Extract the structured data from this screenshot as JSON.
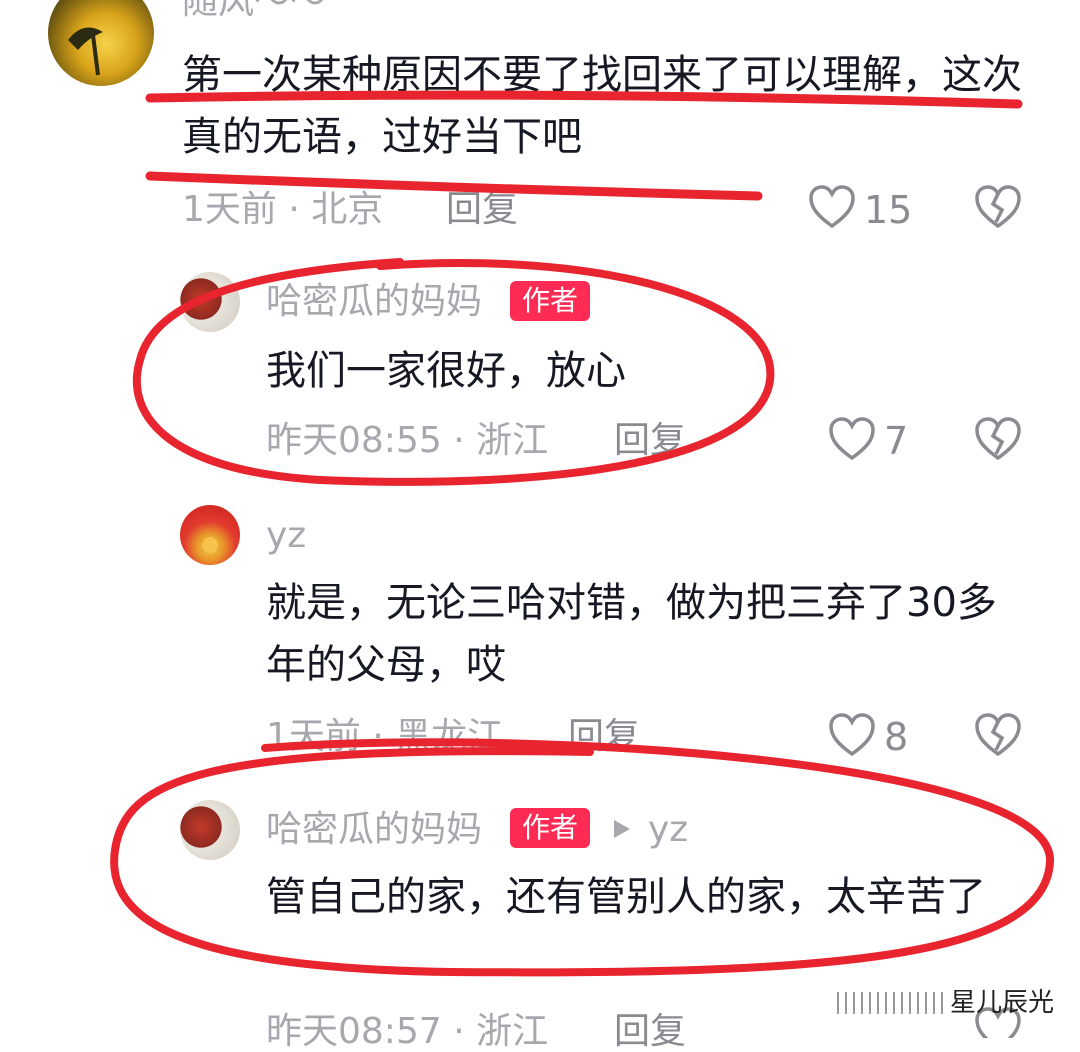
{
  "colors": {
    "accent": "#fe2c55",
    "annotation": "#e8242f",
    "meta": "#a7a8ad"
  },
  "comments": [
    {
      "name": "随风～～",
      "text": "第一次某种原因不要了找回来了可以理解，这次真的无语，过好当下吧",
      "time": "1天前 · 北京",
      "reply": "回复",
      "likes": "15"
    },
    {
      "name": "哈密瓜的妈妈",
      "badge": "作者",
      "text": "我们一家很好，放心",
      "time": "昨天08:55 · 浙江",
      "reply": "回复",
      "likes": "7"
    },
    {
      "name": "yz",
      "text": "就是，无论三哈对错，做为把三弃了30多年的父母，哎",
      "time": "1天前 · 黑龙江",
      "reply": "回复",
      "likes": "8"
    },
    {
      "name": "哈密瓜的妈妈",
      "badge": "作者",
      "reply_to": "yz",
      "text": "管自己的家，还有管别人的家，太辛苦了",
      "time": "昨天08:57 · 浙江",
      "reply": "回复"
    }
  ],
  "watermark": "星儿辰光"
}
